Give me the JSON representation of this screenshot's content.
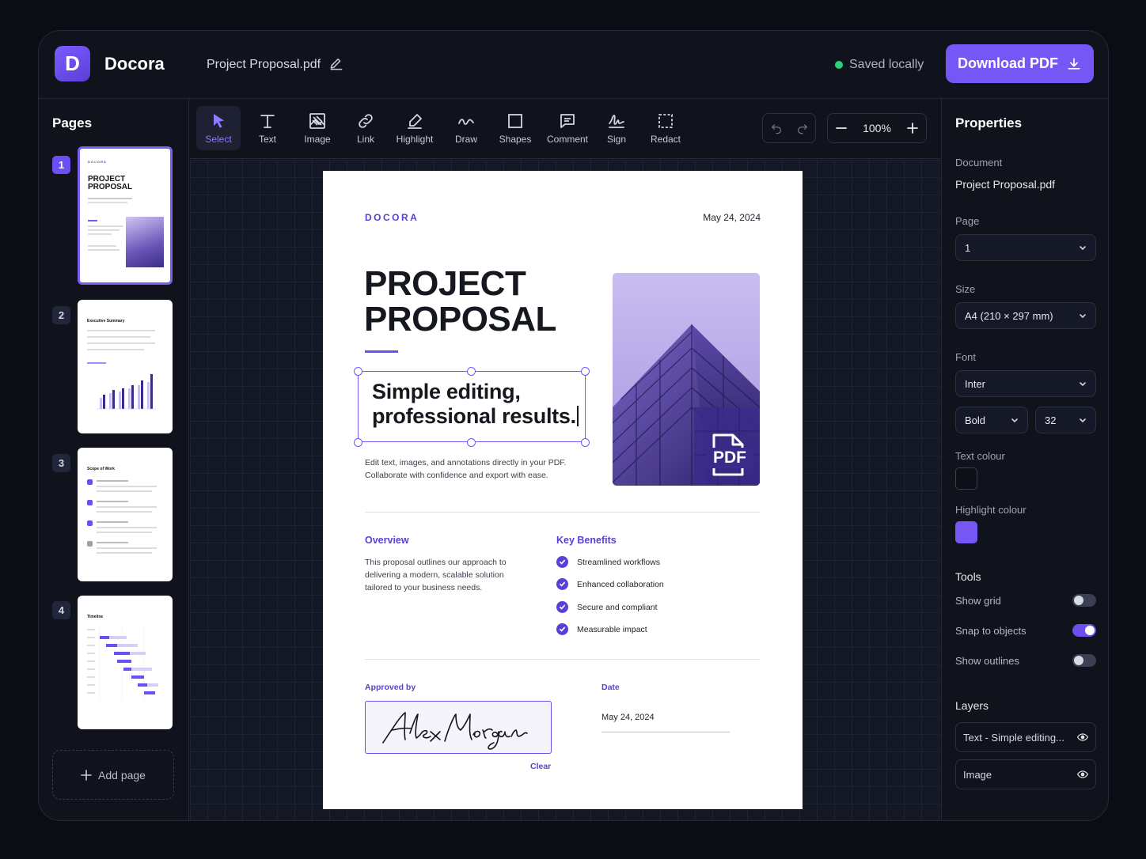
{
  "app": {
    "logo_letter": "D",
    "name": "Docora"
  },
  "header": {
    "filename": "Project Proposal.pdf",
    "save_status": "Saved locally",
    "download_label": "Download PDF"
  },
  "sidebar": {
    "title": "Pages",
    "pages": [
      {
        "number": "1",
        "active": true
      },
      {
        "number": "2",
        "active": false
      },
      {
        "number": "3",
        "active": false
      },
      {
        "number": "4",
        "active": false
      }
    ],
    "thumbs": {
      "p1_brand": "DOCORA",
      "p1_title_line1": "PROJECT",
      "p1_title_line2": "PROPOSAL",
      "p2_title": "Executive Summary",
      "p3_title": "Scope of Work",
      "p4_title": "Timeline"
    },
    "add_page_label": "Add page"
  },
  "toolbar": {
    "tools": [
      {
        "label": "Select",
        "icon": "cursor-icon",
        "active": true
      },
      {
        "label": "Text",
        "icon": "text-icon"
      },
      {
        "label": "Image",
        "icon": "image-icon"
      },
      {
        "label": "Link",
        "icon": "link-icon"
      },
      {
        "label": "Highlight",
        "icon": "highlighter-icon"
      },
      {
        "label": "Draw",
        "icon": "squiggle-icon"
      },
      {
        "label": "Shapes",
        "icon": "square-icon"
      },
      {
        "label": "Comment",
        "icon": "comment-icon"
      },
      {
        "label": "Sign",
        "icon": "signature-icon"
      },
      {
        "label": "Redact",
        "icon": "redact-icon"
      }
    ],
    "zoom": "100%"
  },
  "document": {
    "brand": "DOCORA",
    "date": "May 24, 2024",
    "title_line1": "PROJECT",
    "title_line2": "PROPOSAL",
    "headline_line1": "Simple editing,",
    "headline_line2": "professional results.",
    "sub_line1": "Edit text, images, and annotations directly in your PDF.",
    "sub_line2": "Collaborate with confidence and export with ease.",
    "image_badge": "PDF",
    "overview_title": "Overview",
    "overview_line1": "This proposal outlines our approach to",
    "overview_line2": "delivering a modern, scalable solution",
    "overview_line3": "tailored to your business needs.",
    "benefits_title": "Key Benefits",
    "benefits": [
      "Streamlined workflows",
      "Enhanced collaboration",
      "Secure and compliant",
      "Measurable impact"
    ],
    "approved_label": "Approved by",
    "signature": "Alex Morgan",
    "clear_label": "Clear",
    "date_label": "Date",
    "sig_date": "May 24, 2024"
  },
  "properties": {
    "title": "Properties",
    "document_label": "Document",
    "document_value": "Project Proposal.pdf",
    "page_label": "Page",
    "page_value": "1",
    "size_label": "Size",
    "size_value": "A4 (210 × 297 mm)",
    "font_label": "Font",
    "font_value": "Inter",
    "weight_value": "Bold",
    "font_size_value": "32",
    "text_colour_label": "Text colour",
    "text_colour": "#0d0f16",
    "highlight_colour_label": "Highlight colour",
    "highlight_colour": "#7457f5",
    "tools_label": "Tools",
    "toggles": [
      {
        "label": "Show grid",
        "on": false
      },
      {
        "label": "Snap to objects",
        "on": true
      },
      {
        "label": "Show outlines",
        "on": false
      }
    ],
    "layers_label": "Layers",
    "layers": [
      "Text - Simple editing...",
      "Image"
    ]
  },
  "colors": {
    "accent": "#7457f5",
    "saved_dot": "#2ecf7a",
    "background": "#0b0d14"
  }
}
